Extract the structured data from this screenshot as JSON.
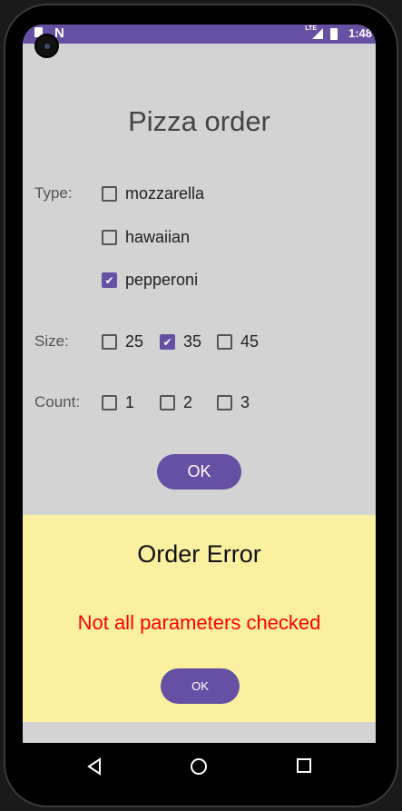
{
  "status": {
    "time": "1:48",
    "network": "LTE"
  },
  "title": "Pizza order",
  "type": {
    "label": "Type:",
    "options": [
      {
        "label": "mozzarella",
        "checked": false
      },
      {
        "label": "hawaiian",
        "checked": false
      },
      {
        "label": "pepperoni",
        "checked": true
      }
    ]
  },
  "size": {
    "label": "Size:",
    "options": [
      {
        "label": "25",
        "checked": false
      },
      {
        "label": "35",
        "checked": true
      },
      {
        "label": "45",
        "checked": false
      }
    ]
  },
  "count": {
    "label": "Count:",
    "options": [
      {
        "label": "1",
        "checked": false
      },
      {
        "label": "2",
        "checked": false
      },
      {
        "label": "3",
        "checked": false
      }
    ]
  },
  "ok_label": "OK",
  "dialog": {
    "title": "Order Error",
    "message": "Not all parameters checked",
    "ok_label": "OK"
  },
  "colors": {
    "accent": "#6650a4",
    "dialog_bg": "#fbf0a0",
    "error": "#ff0000"
  }
}
